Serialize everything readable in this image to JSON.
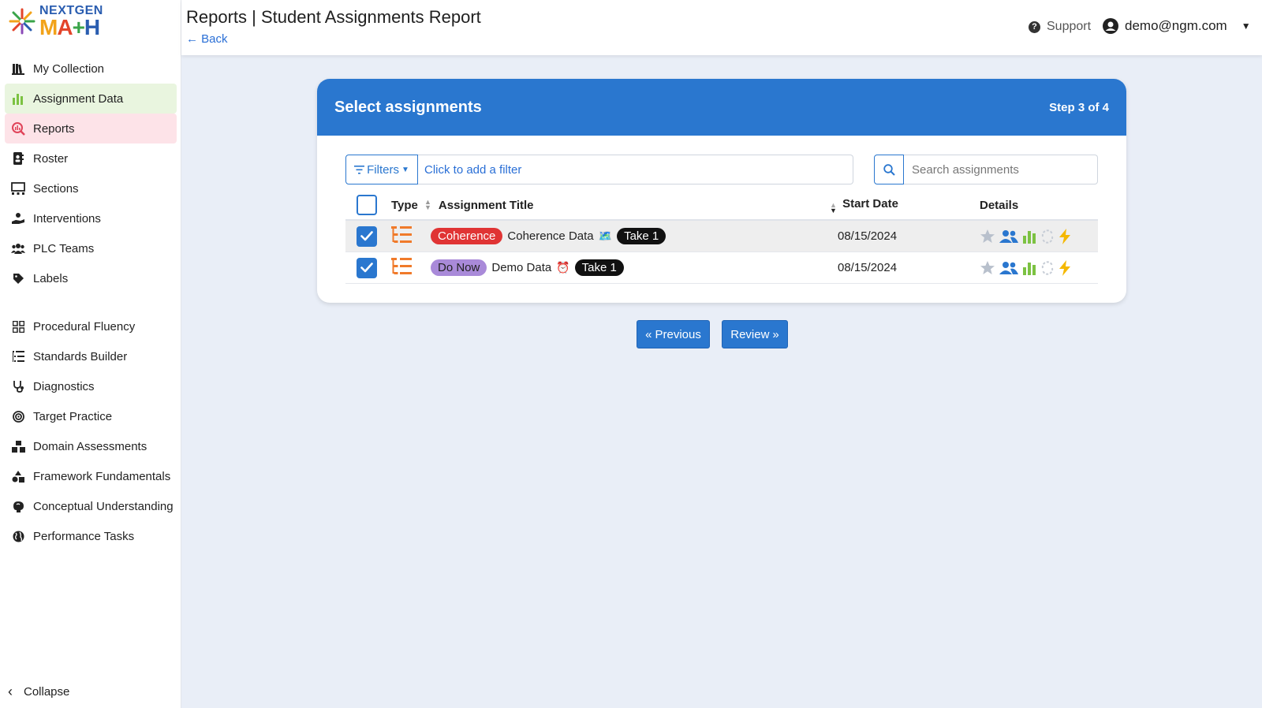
{
  "logo": {
    "top": "NEXTGEN",
    "bottom": [
      "M",
      "A",
      "+",
      "H"
    ]
  },
  "header": {
    "title": "Reports | Student Assignments Report",
    "back": "Back",
    "support": "Support",
    "user_email": "demo@ngm.com"
  },
  "sidebar": {
    "items": [
      {
        "label": "My Collection",
        "icon": "library-icon"
      },
      {
        "label": "Assignment Data",
        "icon": "bar-chart-icon",
        "active": "green"
      },
      {
        "label": "Reports",
        "icon": "magnify-chart-icon",
        "active": "pink"
      },
      {
        "label": "Roster",
        "icon": "address-book-icon"
      },
      {
        "label": "Sections",
        "icon": "sections-icon"
      },
      {
        "label": "Interventions",
        "icon": "hand-icon"
      },
      {
        "label": "PLC Teams",
        "icon": "people-icon"
      },
      {
        "label": "Labels",
        "icon": "tag-icon"
      }
    ],
    "items2": [
      {
        "label": "Procedural Fluency",
        "icon": "grid-icon"
      },
      {
        "label": "Standards Builder",
        "icon": "list-icon"
      },
      {
        "label": "Diagnostics",
        "icon": "stethoscope-icon"
      },
      {
        "label": "Target Practice",
        "icon": "target-icon"
      },
      {
        "label": "Domain Assessments",
        "icon": "cubes-icon"
      },
      {
        "label": "Framework Fundamentals",
        "icon": "shapes-icon"
      },
      {
        "label": "Conceptual Understanding",
        "icon": "brain-icon"
      },
      {
        "label": "Performance Tasks",
        "icon": "globe-icon"
      }
    ],
    "collapse": "Collapse"
  },
  "card": {
    "title": "Select assignments",
    "step": "Step 3 of 4",
    "filters_label": "Filters",
    "filter_placeholder": "Click to add a filter",
    "search_placeholder": "Search assignments"
  },
  "table": {
    "headers": {
      "type": "Type",
      "title": "Assignment Title",
      "date": "Start Date",
      "details": "Details"
    },
    "rows": [
      {
        "checked": true,
        "tag": "Coherence",
        "tag_color": "#e03434",
        "title": "Coherence Data",
        "emoji": "🗺️",
        "take": "Take 1",
        "date": "08/15/2024"
      },
      {
        "checked": true,
        "tag": "Do Now",
        "tag_color": "#a98ad9",
        "title": "Demo Data",
        "emoji": "⏰",
        "take": "Take 1",
        "date": "08/15/2024"
      }
    ]
  },
  "buttons": {
    "previous": "Previous",
    "review": "Review"
  },
  "colors": {
    "primary": "#2a77cf",
    "orange": "#f07a2a",
    "green_icon": "#7cc242",
    "yellow_icon": "#f5b800"
  }
}
